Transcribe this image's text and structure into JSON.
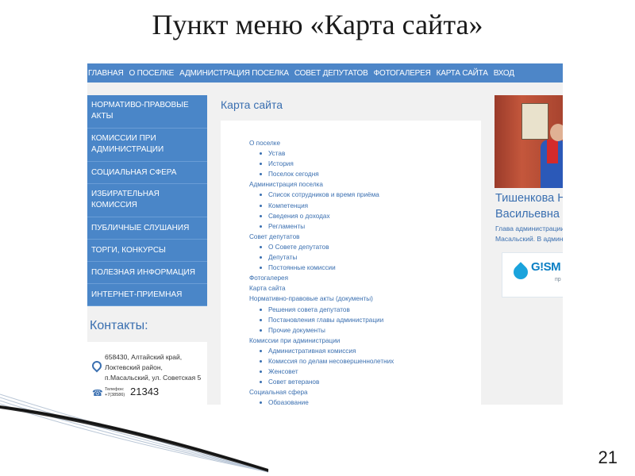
{
  "slide": {
    "title": "Пункт меню «Карта сайта»",
    "number": "21"
  },
  "top_nav": [
    "ГЛАВНАЯ",
    "О ПОСЕЛКЕ",
    "АДМИНИСТРАЦИЯ ПОСЕЛКА",
    "СОВЕТ ДЕПУТАТОВ",
    "ФОТОГАЛЕРЕЯ",
    "КАРТА САЙТА",
    "ВХОД"
  ],
  "sidebar": [
    "НОРМАТИВО-ПРАВОВЫЕ АКТЫ",
    "КОМИССИИ ПРИ АДМИНИСТРАЦИИ",
    "СОЦИАЛЬНАЯ СФЕРА",
    "ИЗБИРАТЕЛЬНАЯ КОМИССИЯ",
    "ПУБЛИЧНЫЕ СЛУШАНИЯ",
    "ТОРГИ, КОНКУРСЫ",
    "ПОЛЕЗНАЯ ИНФОРМАЦИЯ",
    "ИНТЕРНЕТ-ПРИЕМНАЯ"
  ],
  "contacts": {
    "title": "Контакты:",
    "address_line1": "658430, Алтайский край,",
    "address_line2": "Локтевский район,",
    "address_line3": "п.Масальский, ул. Советская 5",
    "phone_label_1": "Телефон:",
    "phone_label_2": "+7(38586)",
    "phone_number": "21343",
    "icons": [
      "map-pin-icon",
      "phone-icon"
    ]
  },
  "content": {
    "title": "Карта сайта",
    "sitemap": [
      {
        "text": "О поселке",
        "level": 0
      },
      {
        "text": "Устав",
        "level": 1
      },
      {
        "text": "История",
        "level": 1
      },
      {
        "text": "Поселок сегодня",
        "level": 1
      },
      {
        "text": "Администрация поселка",
        "level": 0
      },
      {
        "text": "Список сотрудников и время приёма",
        "level": 1
      },
      {
        "text": "Компетенция",
        "level": 1
      },
      {
        "text": "Сведения о доходах",
        "level": 1
      },
      {
        "text": "Регламенты",
        "level": 1
      },
      {
        "text": "Совет депутатов",
        "level": 0
      },
      {
        "text": "О Совете депутатов",
        "level": 1
      },
      {
        "text": "Депутаты",
        "level": 1
      },
      {
        "text": "Постоянные комиссии",
        "level": 1
      },
      {
        "text": "Фотогалерея",
        "level": 0
      },
      {
        "text": "Карта сайта",
        "level": 0
      },
      {
        "text": "Нормативно-правовые акты (документы)",
        "level": 0
      },
      {
        "text": "Решения совета депутатов",
        "level": 1
      },
      {
        "text": "Постановления главы администрации",
        "level": 1
      },
      {
        "text": "Прочие документы",
        "level": 1
      },
      {
        "text": "Комиссии при администрации",
        "level": 0
      },
      {
        "text": "Административная комиссия",
        "level": 1
      },
      {
        "text": "Комиссия по делам несовершеннолетних",
        "level": 1
      },
      {
        "text": "Женсовет",
        "level": 1
      },
      {
        "text": "Совет ветеранов",
        "level": 1
      },
      {
        "text": "Социальная сфера",
        "level": 0
      },
      {
        "text": "Образование",
        "level": 1
      }
    ]
  },
  "right_panel": {
    "name_line1": "Тишенкова Н",
    "name_line2": "Васильевна",
    "role_line1": "Глава администрации",
    "role_line2": "Масальский. В админ",
    "logo_text": "G!SM",
    "logo_sub": "пр"
  },
  "colors": {
    "nav_blue": "#4d86c8",
    "link_blue": "#3a6fb0",
    "page_bg": "#f1f1f1"
  }
}
